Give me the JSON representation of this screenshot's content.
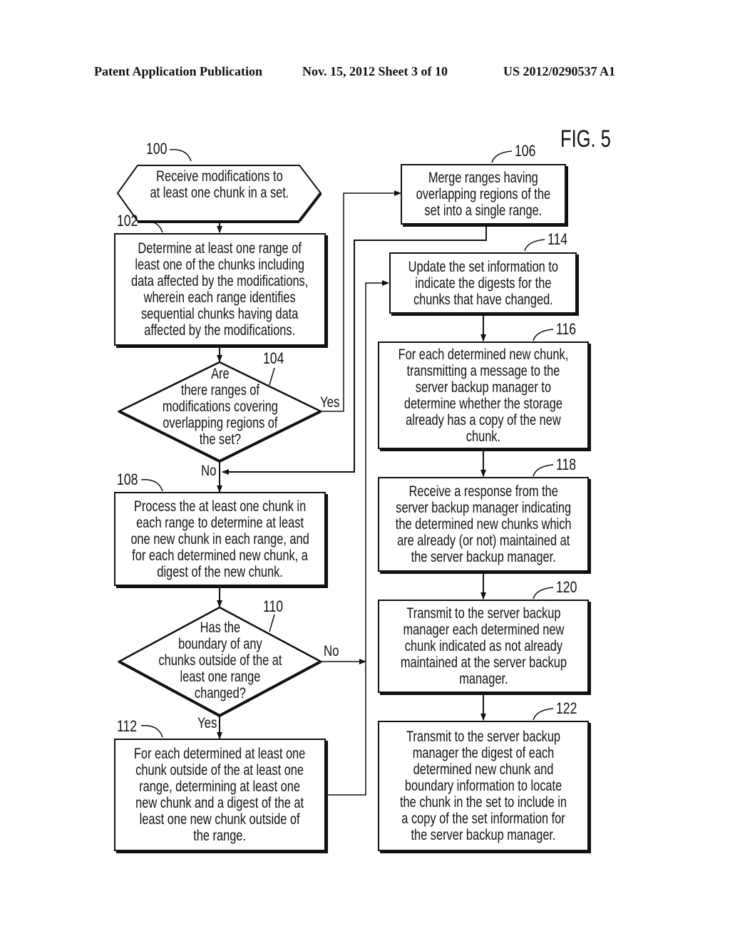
{
  "header": {
    "publication": "Patent Application Publication",
    "date_sheet": "Nov. 15, 2012   Sheet 3 of 10",
    "number": "US 2012/0290537 A1"
  },
  "figure_label": "FIG. 5",
  "steps": {
    "s100": {
      "ref": "100",
      "lines": [
        "Receive modifications to",
        "at least one chunk in a set."
      ]
    },
    "s102": {
      "ref": "102",
      "lines": [
        "Determine at least one range of",
        "least one of the chunks including",
        "data affected by the modifications,",
        "wherein each range identifies",
        "sequential chunks having data",
        "affected by the modifications."
      ]
    },
    "s104": {
      "ref": "104",
      "lines": [
        "Are",
        "there ranges of",
        "modifications covering",
        "overlapping regions of",
        "the set?"
      ],
      "yes": "Yes",
      "no": "No"
    },
    "s106": {
      "ref": "106",
      "lines": [
        "Merge ranges having",
        "overlapping regions of the",
        "set into a single range."
      ]
    },
    "s108": {
      "ref": "108",
      "lines": [
        "Process the at least one chunk in",
        "each range to determine at least",
        "one new chunk in each range, and",
        "for each determined new chunk, a",
        "digest of the new chunk."
      ]
    },
    "s110": {
      "ref": "110",
      "lines": [
        "Has the",
        "boundary of any",
        "chunks outside of the at",
        "least one range",
        "changed?"
      ],
      "yes": "Yes",
      "no": "No"
    },
    "s112": {
      "ref": "112",
      "lines": [
        "For each determined at least one",
        "chunk outside of the at least one",
        "range, determining at least one",
        "new chunk and a digest of the at",
        "least one new chunk outside of",
        "the range."
      ]
    },
    "s114": {
      "ref": "114",
      "lines": [
        "Update the set information to",
        "indicate the digests for the",
        "chunks that have changed."
      ]
    },
    "s116": {
      "ref": "116",
      "lines": [
        "For each determined new chunk,",
        "transmitting a message to the",
        "server backup manager to",
        "determine whether the storage",
        "already has a copy of the new",
        "chunk."
      ]
    },
    "s118": {
      "ref": "118",
      "lines": [
        "Receive a response from the",
        "server backup manager indicating",
        "the determined new chunks which",
        "are already (or not) maintained at",
        "the server backup manager."
      ]
    },
    "s120": {
      "ref": "120",
      "lines": [
        "Transmit to the server backup",
        "manager each determined new",
        "chunk indicated as not already",
        "maintained at the server backup",
        "manager."
      ]
    },
    "s122": {
      "ref": "122",
      "lines": [
        "Transmit to the server backup",
        "manager the digest of each",
        "determined new chunk and",
        "boundary information to locate",
        "the chunk in the set to include in",
        "a copy of the set information for",
        "the server backup manager."
      ]
    }
  }
}
